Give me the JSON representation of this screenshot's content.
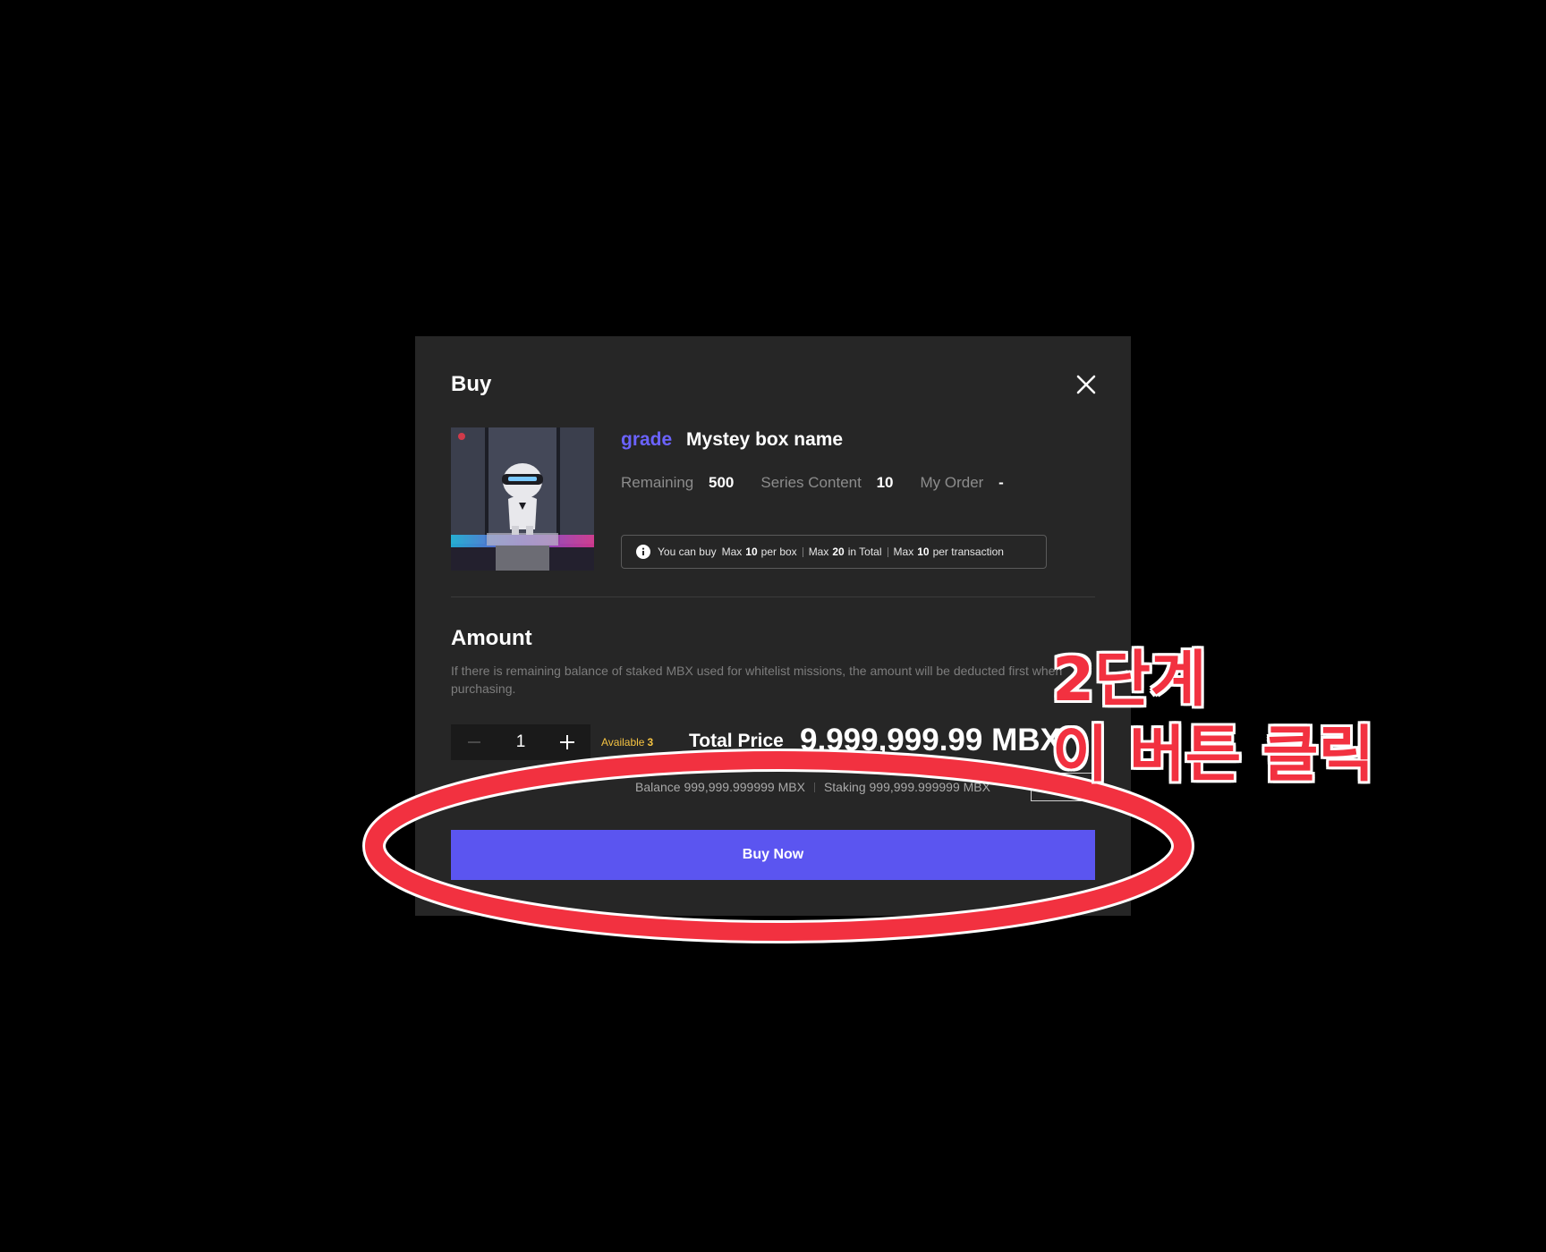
{
  "modal": {
    "title": "Buy",
    "close_icon": "close-icon"
  },
  "product": {
    "grade": "grade",
    "name": "Mystey box name",
    "stats": [
      {
        "label": "Remaining",
        "value": "500"
      },
      {
        "label": "Series Content",
        "value": "10"
      },
      {
        "label": "My Order",
        "value": "-"
      }
    ],
    "limits": {
      "prefix": "You can buy",
      "max_label": "Max",
      "per_box_value": "10",
      "per_box_suffix": "per box",
      "total_value": "20",
      "total_suffix": "in Total",
      "per_tx_value": "10",
      "per_tx_suffix": "per transaction"
    }
  },
  "amount": {
    "title": "Amount",
    "description": "If there is remaining balance of staked MBX used for whitelist missions, the amount will be deducted first when purchasing.",
    "quantity": "1",
    "available_label": "Available",
    "available_value": "3",
    "total_price_label": "Total Price",
    "total_price_value": "9,999,999.99 MBX",
    "balance": "Balance 999,999.999999 MBX",
    "staking": "Staking 999,999.999999 MBX"
  },
  "actions": {
    "buy_now": "Buy Now"
  },
  "annotation": {
    "step": "2단계",
    "instruction": "이 버튼 클릭",
    "color": "#f23140"
  },
  "colors": {
    "accent": "#5b55f0",
    "grade": "#6b63ff",
    "available": "#f5c342",
    "modal_bg": "#262626"
  }
}
